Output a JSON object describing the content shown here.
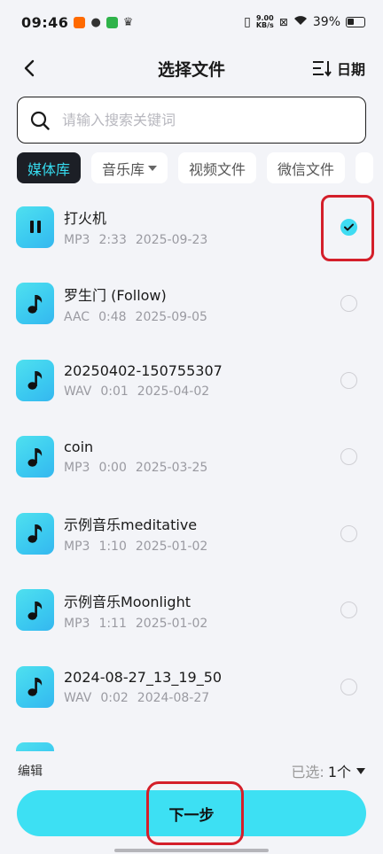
{
  "status_bar": {
    "time": "09:46",
    "net_speed_value": "9.00",
    "net_speed_unit": "KB/s",
    "battery": "39%"
  },
  "header": {
    "title": "选择文件",
    "sort_label": "日期"
  },
  "search": {
    "placeholder": "请输入搜索关键词",
    "value": ""
  },
  "tabs": [
    {
      "label": "媒体库",
      "active": true
    },
    {
      "label": "音乐库",
      "active": false
    },
    {
      "label": "视频文件",
      "active": false
    },
    {
      "label": "微信文件",
      "active": false
    }
  ],
  "files": [
    {
      "name": "打火机",
      "format": "MP3",
      "duration": "2:33",
      "date": "2025-09-23",
      "selected": true,
      "icon": "pause-icon"
    },
    {
      "name": "罗生门 (Follow)",
      "format": "AAC",
      "duration": "0:48",
      "date": "2025-09-05",
      "selected": false,
      "icon": "music-note-icon"
    },
    {
      "name": "20250402-150755307",
      "format": "WAV",
      "duration": "0:01",
      "date": "2025-04-02",
      "selected": false,
      "icon": "music-note-icon"
    },
    {
      "name": "coin",
      "format": "MP3",
      "duration": "0:00",
      "date": "2025-03-25",
      "selected": false,
      "icon": "music-note-icon"
    },
    {
      "name": "示例音乐meditative",
      "format": "MP3",
      "duration": "1:10",
      "date": "2025-01-02",
      "selected": false,
      "icon": "music-note-icon"
    },
    {
      "name": "示例音乐Moonlight",
      "format": "MP3",
      "duration": "1:11",
      "date": "2025-01-02",
      "selected": false,
      "icon": "music-note-icon"
    },
    {
      "name": "2024-08-27_13_19_50",
      "format": "WAV",
      "duration": "0:02",
      "date": "2024-08-27",
      "selected": false,
      "icon": "music-note-icon"
    }
  ],
  "footer": {
    "edit_label": "编辑",
    "selected_label": "已选:",
    "selected_count": "1个",
    "next_label": "下一步"
  },
  "colors": {
    "accent": "#3de0f3",
    "highlight": "#d41f2a",
    "active_tab_bg": "#1c1f26",
    "active_tab_text": "#36dcf0"
  }
}
